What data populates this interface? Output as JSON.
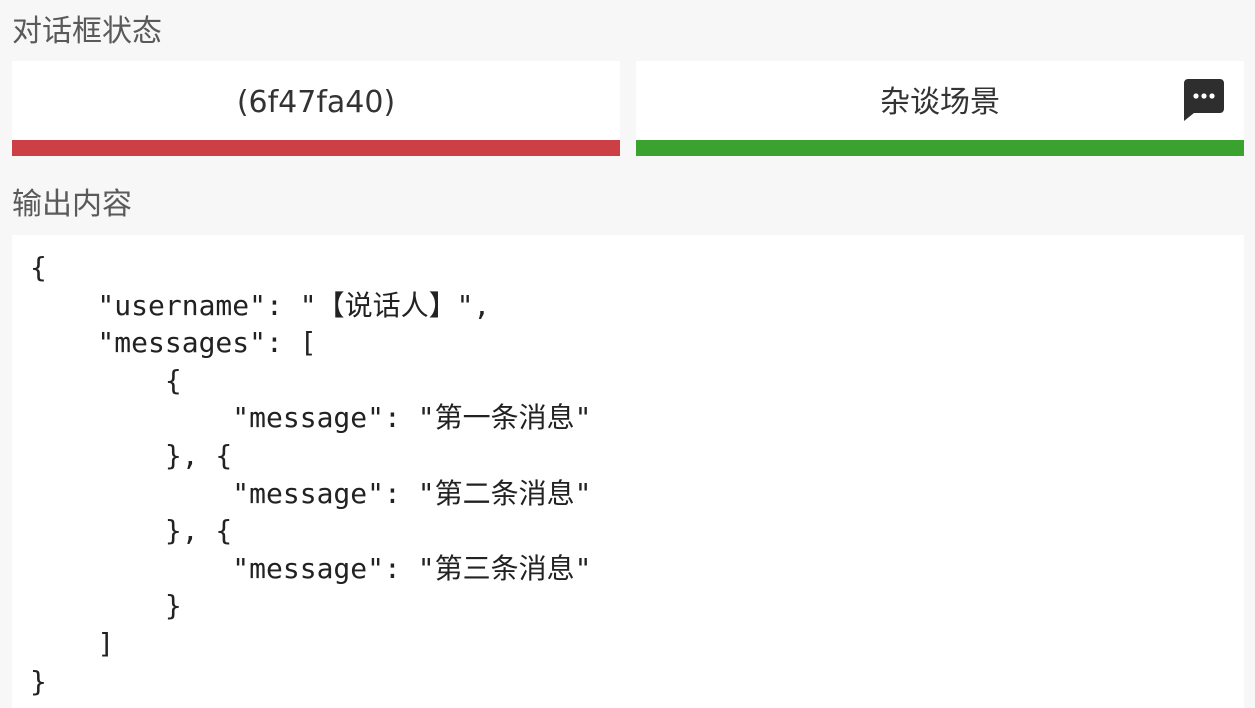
{
  "status_section": {
    "title": "对话框状态",
    "dialog_id": "(6f47fa40)",
    "scene": "杂谈场景",
    "scene_icon": "chat-bubble-icon"
  },
  "output_section": {
    "title": "输出内容",
    "content": "{\n    \"username\": \"【说话人】\",\n    \"messages\": [\n        {\n            \"message\": \"第一条消息\"\n        }, {\n            \"message\": \"第二条消息\"\n        }, {\n            \"message\": \"第三条消息\"\n        }\n    ]\n}"
  },
  "colors": {
    "id_bar": "#cc3f45",
    "scene_bar": "#3aa22f",
    "icon": "#2e2e2e"
  }
}
